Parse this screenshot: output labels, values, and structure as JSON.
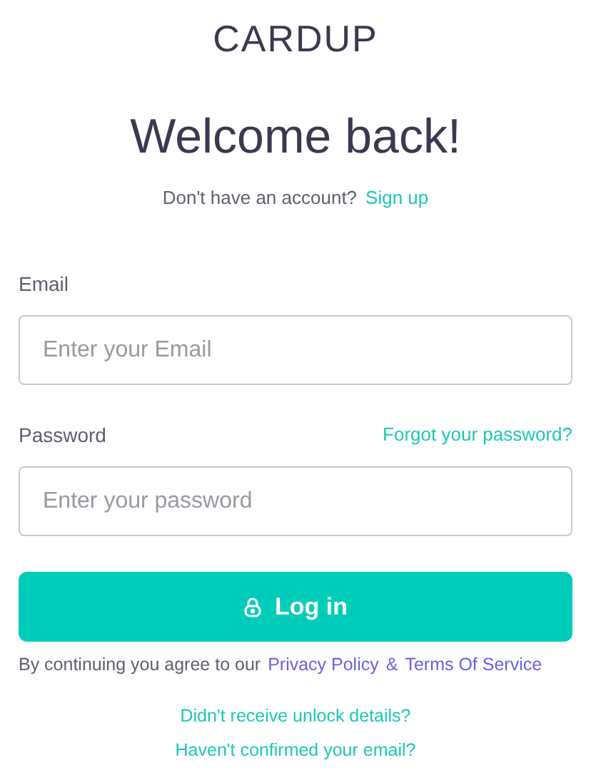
{
  "logo": "CARDUP",
  "title": "Welcome back!",
  "signup": {
    "text": "Don't have an account?",
    "link": "Sign up"
  },
  "fields": [
    {
      "label": "Email",
      "placeholder": "Enter your Email"
    },
    {
      "label": "Password",
      "placeholder": "Enter your password",
      "link": "Forgot your password?"
    }
  ],
  "login_button": "Log in",
  "terms": {
    "text": "By continuing you agree to our",
    "privacy": "Privacy Policy",
    "amp": "&",
    "tos": "Terms Of Service"
  },
  "links": [
    "Didn't receive unlock details?",
    "Haven't confirmed your email?"
  ]
}
